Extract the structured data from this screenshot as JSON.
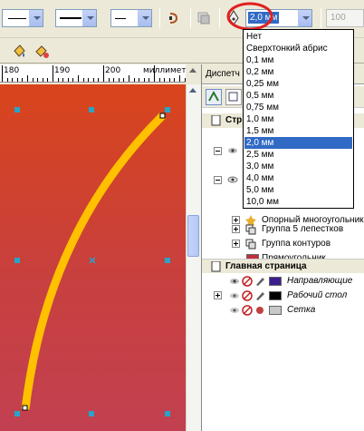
{
  "toolbar": {
    "width_value": "2,0 мм",
    "spin_value": "100"
  },
  "ruler": {
    "labels": [
      "180",
      "190",
      "200"
    ],
    "units": "миллиметры"
  },
  "docker": {
    "tab_label": "Диспетч",
    "layer_rows": [
      {
        "label": "Стр"
      },
      {
        "label": "Опорный многоугольник"
      },
      {
        "label": "Группа 5 лепестков"
      },
      {
        "label": "Группа контуров"
      },
      {
        "label": "Прямоугольник"
      }
    ],
    "master_page": "Главная страница",
    "master_layers": [
      {
        "label": "Направляющие",
        "color": "#3c1e8c"
      },
      {
        "label": "Рабочий стол",
        "color": "#000000"
      },
      {
        "label": "Сетка",
        "color": "#c8c8c8"
      }
    ]
  },
  "dropdown": {
    "options": [
      "Нет",
      "Сверхтонкий абрис",
      "0,1 мм",
      "0,2 мм",
      "0,25 мм",
      "0,5 мм",
      "0,75 мм",
      "1,0 мм",
      "1,5 мм",
      "2,0 мм",
      "2,5 мм",
      "3,0 мм",
      "4,0 мм",
      "5,0 мм",
      "10,0 мм"
    ],
    "selected_index": 9
  },
  "colors": {
    "accent_ring": "#e02020",
    "selection": "#316ac5",
    "curve": "#ffc000",
    "handle": "#27a4c9"
  }
}
